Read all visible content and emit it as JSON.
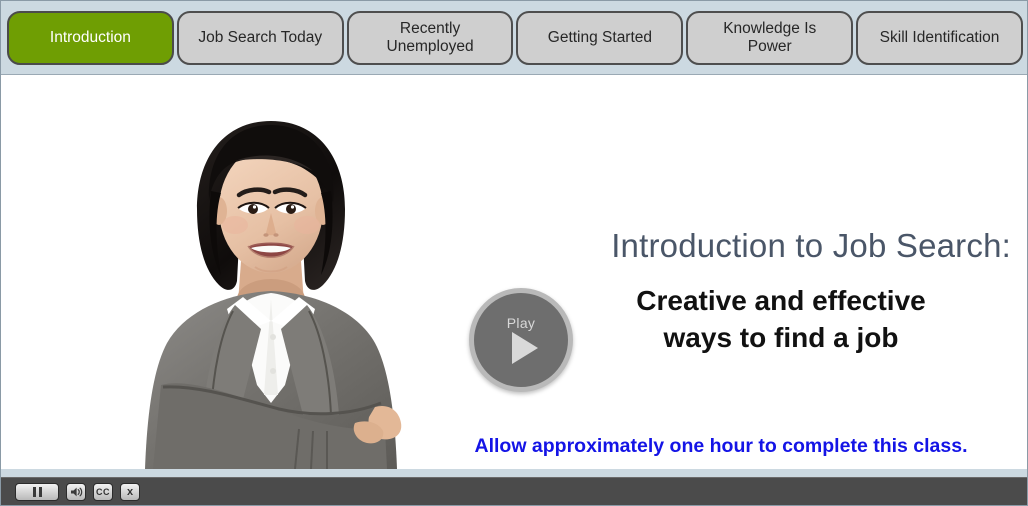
{
  "tabs": [
    {
      "label": "Introduction",
      "active": true
    },
    {
      "label": "Job Search Today",
      "active": false
    },
    {
      "label": "Recently\nUnemployed",
      "active": false
    },
    {
      "label": "Getting Started",
      "active": false
    },
    {
      "label": "Knowledge Is\nPower",
      "active": false
    },
    {
      "label": "Skill Identification",
      "active": false
    }
  ],
  "slide": {
    "title": "Introduction to Job Search:",
    "subtitle": "Creative and effective\nways to find a job",
    "note": "Allow approximately one hour to complete this class.",
    "play_button": {
      "label": "Play",
      "icon": "play-triangle-icon"
    },
    "photo_alt": "Smiling businesswoman in grey suit with arms crossed"
  },
  "toolbar": {
    "pause_label": "Pause",
    "volume_label": "Volume",
    "cc_label": "CC",
    "close_label": "x"
  },
  "colors": {
    "header_bg": "#ccd9e1",
    "active_tab": "#6f9e03",
    "inactive_tab": "#cfcfcf",
    "title": "#4a5668",
    "note": "#1414e6",
    "toolbar_bg": "#4b4b4b"
  }
}
